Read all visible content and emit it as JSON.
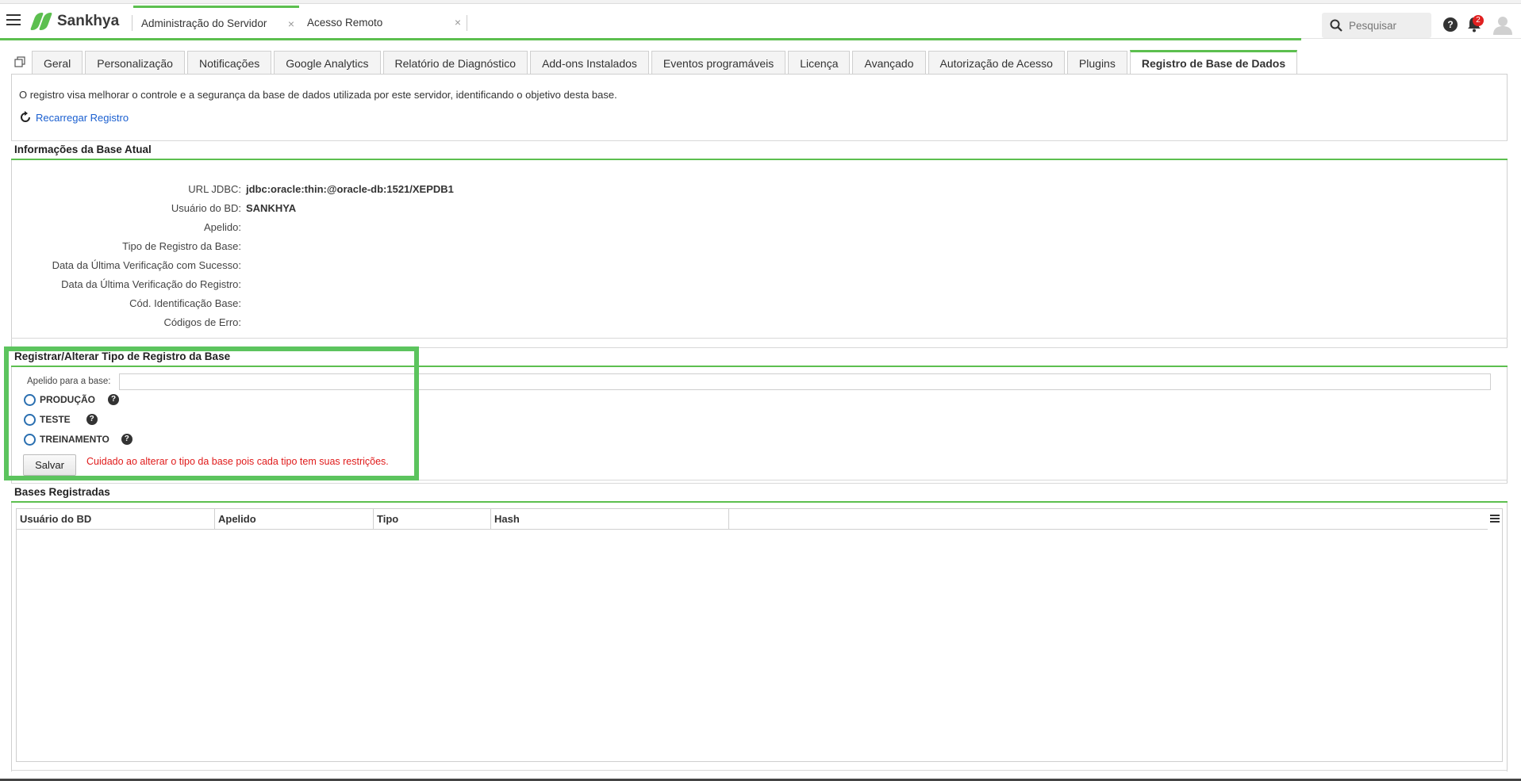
{
  "header": {
    "brand": "Sankhya",
    "tabs": [
      {
        "label": "Administração do Servidor",
        "close": "×"
      },
      {
        "label": "Acesso Remoto",
        "close": "×"
      }
    ],
    "search_placeholder": "Pesquisar",
    "notification_count": "2",
    "help": "?"
  },
  "settings_tabs": [
    "Geral",
    "Personalização",
    "Notificações",
    "Google Analytics",
    "Relatório de Diagnóstico",
    "Add-ons Instalados",
    "Eventos programáveis",
    "Licença",
    "Avançado",
    "Autorização de Acesso",
    "Plugins",
    "Registro de Base de Dados"
  ],
  "intro_text": "O registro visa melhorar o controle e a segurança da base de dados utilizada por este servidor, identificando o objetivo desta base.",
  "reload_link": "Recarregar Registro",
  "current_info": {
    "title": "Informações da Base Atual",
    "rows": [
      {
        "label": "URL JDBC:",
        "value": "jdbc:oracle:thin:@oracle-db:1521/XEPDB1"
      },
      {
        "label": "Usuário do BD:",
        "value": "SANKHYA"
      },
      {
        "label": "Apelido:",
        "value": ""
      },
      {
        "label": "Tipo de Registro da Base:",
        "value": ""
      },
      {
        "label": "Data da Última Verificação com Sucesso:",
        "value": ""
      },
      {
        "label": "Data da Última Verificação do Registro:",
        "value": ""
      },
      {
        "label": "Cód. Identificação Base:",
        "value": ""
      },
      {
        "label": "Códigos de Erro:",
        "value": ""
      }
    ]
  },
  "register": {
    "title": "Registrar/Alterar Tipo de Registro da Base",
    "alias_label": "Apelido para a base:",
    "alias_value": "",
    "options": [
      "PRODUÇÃO",
      "TESTE",
      "TREINAMENTO"
    ],
    "save_label": "Salvar",
    "warning": "Cuidado ao alterar o tipo da base pois cada tipo tem suas restrições."
  },
  "registered": {
    "title": "Bases Registradas",
    "columns": [
      "Usuário do BD",
      "Apelido",
      "Tipo",
      "Hash"
    ]
  },
  "colors": {
    "accent": "#5cbf4f",
    "link": "#1a5fd0",
    "warning": "#e01b1b",
    "highlight": "#5cc45e"
  }
}
